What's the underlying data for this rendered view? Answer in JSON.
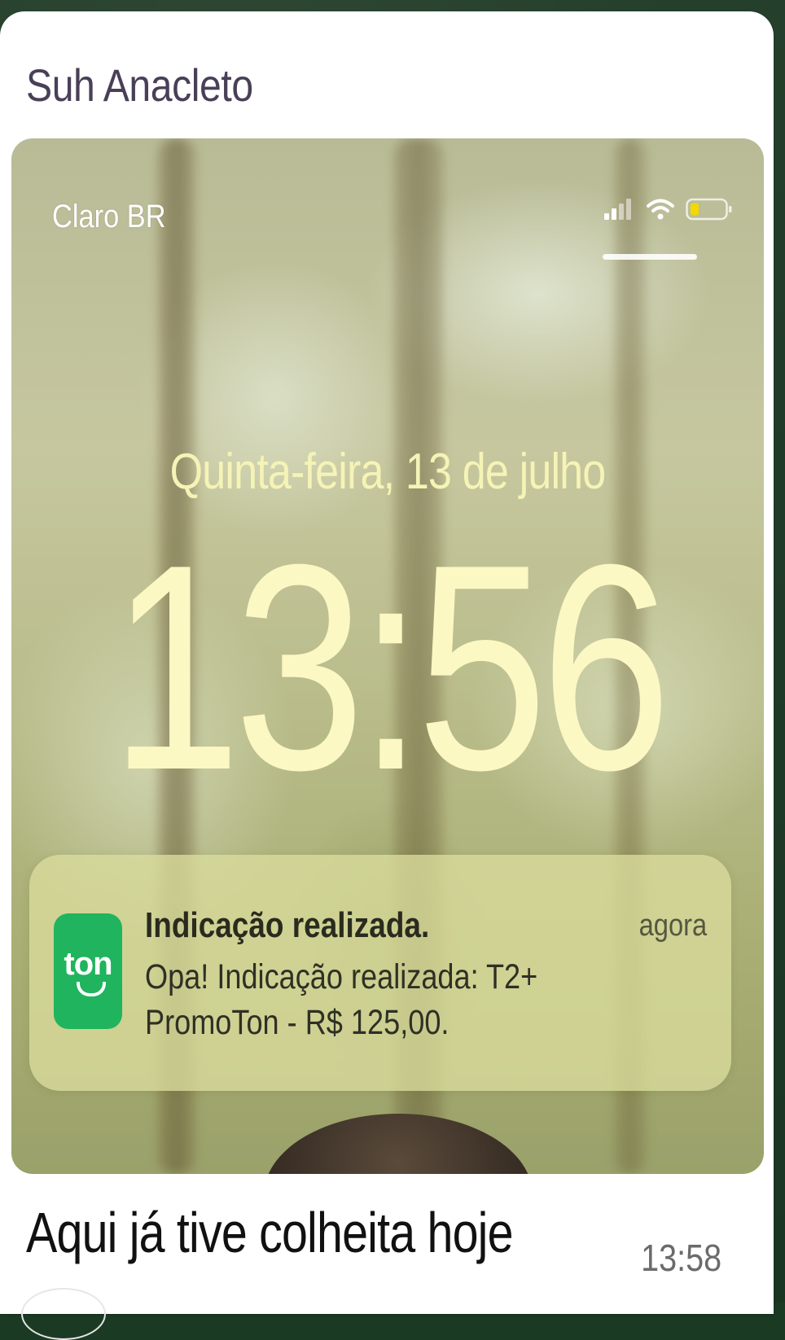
{
  "chat": {
    "sender_name": "Suh Anacleto",
    "caption": "Aqui já tive colheita hoje",
    "sent_time": "13:58"
  },
  "lockscreen": {
    "carrier": "Claro BR",
    "date": "Quinta-feira, 13 de julho",
    "time": "13:56",
    "battery_color": "#f5d800",
    "icons": [
      "cellular-signal-icon",
      "wifi-icon",
      "battery-icon"
    ]
  },
  "notification": {
    "app_icon_text": "ton",
    "app_icon_color": "#1fb45d",
    "title": "Indicação realizada.",
    "time": "agora",
    "body": "Opa! Indicação realizada: T2+ PromoTon - R$ 125,00."
  }
}
